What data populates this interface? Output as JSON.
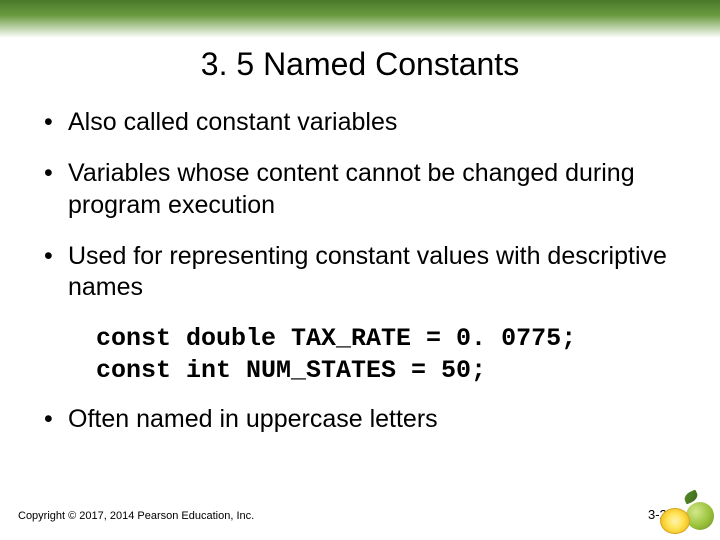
{
  "title": "3. 5 Named Constants",
  "bullets": [
    "Also called constant variables",
    "Variables whose content cannot be changed during program execution",
    "Used for representing constant values with descriptive names"
  ],
  "code_lines": "const double TAX_RATE = 0. 0775;\nconst int NUM_STATES = 50;",
  "bullet_after_code": "Often named in uppercase letters",
  "copyright": "Copyright © 2017, 2014 Pearson Education, Inc.",
  "pagenum": "3-23"
}
